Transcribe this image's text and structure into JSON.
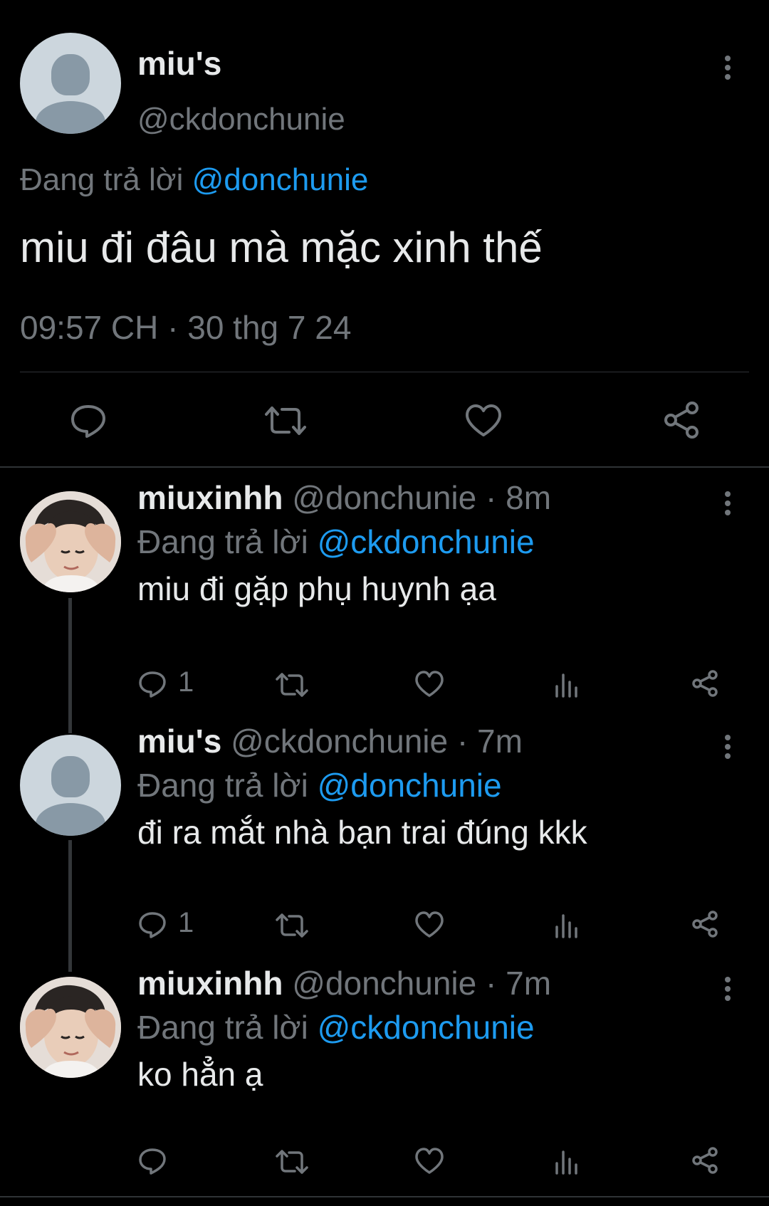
{
  "main_tweet": {
    "display_name": "miu's",
    "handle": "@ckdonchunie",
    "replying_prefix": "Đang trả lời",
    "replying_to": "@donchunie",
    "text": "miu đi đâu mà mặc xinh thế",
    "time": "09:57 CH",
    "separator": " · ",
    "date": "30 thg 7 24",
    "actions": [
      "reply-icon",
      "retweet-icon",
      "like-icon",
      "share-icon"
    ]
  },
  "replies": [
    {
      "display_name": "miuxinhh",
      "handle": "@donchunie",
      "age": "8m",
      "replying_prefix": "Đang trả lời",
      "replying_to": "@ckdonchunie",
      "text": "miu đi gặp phụ huynh ạa",
      "reply_count": "1",
      "avatar": "photo"
    },
    {
      "display_name": "miu's",
      "handle": "@ckdonchunie",
      "age": "7m",
      "replying_prefix": "Đang trả lời",
      "replying_to": "@donchunie",
      "text": "đi ra mắt nhà bạn trai đúng kkk",
      "reply_count": "1",
      "avatar": "default"
    },
    {
      "display_name": "miuxinhh",
      "handle": "@donchunie",
      "age": "7m",
      "replying_prefix": "Đang trả lời",
      "replying_to": "@ckdonchunie",
      "text": "ko hẳn ạ",
      "reply_count": "",
      "avatar": "photo"
    }
  ],
  "colors": {
    "background": "#000000",
    "text": "#e7e9ea",
    "secondary": "#71767b",
    "accent": "#1d9bf0",
    "divider": "#2f3336"
  }
}
